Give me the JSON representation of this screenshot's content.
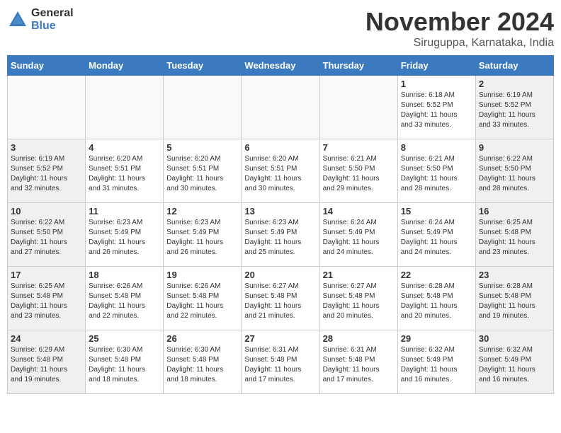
{
  "logo": {
    "general": "General",
    "blue": "Blue"
  },
  "title": "November 2024",
  "location": "Siruguppa, Karnataka, India",
  "weekdays": [
    "Sunday",
    "Monday",
    "Tuesday",
    "Wednesday",
    "Thursday",
    "Friday",
    "Saturday"
  ],
  "weeks": [
    [
      {
        "day": "",
        "info": "",
        "empty": true
      },
      {
        "day": "",
        "info": "",
        "empty": true
      },
      {
        "day": "",
        "info": "",
        "empty": true
      },
      {
        "day": "",
        "info": "",
        "empty": true
      },
      {
        "day": "",
        "info": "",
        "empty": true
      },
      {
        "day": "1",
        "info": "Sunrise: 6:18 AM\nSunset: 5:52 PM\nDaylight: 11 hours\nand 33 minutes."
      },
      {
        "day": "2",
        "info": "Sunrise: 6:19 AM\nSunset: 5:52 PM\nDaylight: 11 hours\nand 33 minutes."
      }
    ],
    [
      {
        "day": "3",
        "info": "Sunrise: 6:19 AM\nSunset: 5:52 PM\nDaylight: 11 hours\nand 32 minutes."
      },
      {
        "day": "4",
        "info": "Sunrise: 6:20 AM\nSunset: 5:51 PM\nDaylight: 11 hours\nand 31 minutes."
      },
      {
        "day": "5",
        "info": "Sunrise: 6:20 AM\nSunset: 5:51 PM\nDaylight: 11 hours\nand 30 minutes."
      },
      {
        "day": "6",
        "info": "Sunrise: 6:20 AM\nSunset: 5:51 PM\nDaylight: 11 hours\nand 30 minutes."
      },
      {
        "day": "7",
        "info": "Sunrise: 6:21 AM\nSunset: 5:50 PM\nDaylight: 11 hours\nand 29 minutes."
      },
      {
        "day": "8",
        "info": "Sunrise: 6:21 AM\nSunset: 5:50 PM\nDaylight: 11 hours\nand 28 minutes."
      },
      {
        "day": "9",
        "info": "Sunrise: 6:22 AM\nSunset: 5:50 PM\nDaylight: 11 hours\nand 28 minutes."
      }
    ],
    [
      {
        "day": "10",
        "info": "Sunrise: 6:22 AM\nSunset: 5:50 PM\nDaylight: 11 hours\nand 27 minutes."
      },
      {
        "day": "11",
        "info": "Sunrise: 6:23 AM\nSunset: 5:49 PM\nDaylight: 11 hours\nand 26 minutes."
      },
      {
        "day": "12",
        "info": "Sunrise: 6:23 AM\nSunset: 5:49 PM\nDaylight: 11 hours\nand 26 minutes."
      },
      {
        "day": "13",
        "info": "Sunrise: 6:23 AM\nSunset: 5:49 PM\nDaylight: 11 hours\nand 25 minutes."
      },
      {
        "day": "14",
        "info": "Sunrise: 6:24 AM\nSunset: 5:49 PM\nDaylight: 11 hours\nand 24 minutes."
      },
      {
        "day": "15",
        "info": "Sunrise: 6:24 AM\nSunset: 5:49 PM\nDaylight: 11 hours\nand 24 minutes."
      },
      {
        "day": "16",
        "info": "Sunrise: 6:25 AM\nSunset: 5:48 PM\nDaylight: 11 hours\nand 23 minutes."
      }
    ],
    [
      {
        "day": "17",
        "info": "Sunrise: 6:25 AM\nSunset: 5:48 PM\nDaylight: 11 hours\nand 23 minutes."
      },
      {
        "day": "18",
        "info": "Sunrise: 6:26 AM\nSunset: 5:48 PM\nDaylight: 11 hours\nand 22 minutes."
      },
      {
        "day": "19",
        "info": "Sunrise: 6:26 AM\nSunset: 5:48 PM\nDaylight: 11 hours\nand 22 minutes."
      },
      {
        "day": "20",
        "info": "Sunrise: 6:27 AM\nSunset: 5:48 PM\nDaylight: 11 hours\nand 21 minutes."
      },
      {
        "day": "21",
        "info": "Sunrise: 6:27 AM\nSunset: 5:48 PM\nDaylight: 11 hours\nand 20 minutes."
      },
      {
        "day": "22",
        "info": "Sunrise: 6:28 AM\nSunset: 5:48 PM\nDaylight: 11 hours\nand 20 minutes."
      },
      {
        "day": "23",
        "info": "Sunrise: 6:28 AM\nSunset: 5:48 PM\nDaylight: 11 hours\nand 19 minutes."
      }
    ],
    [
      {
        "day": "24",
        "info": "Sunrise: 6:29 AM\nSunset: 5:48 PM\nDaylight: 11 hours\nand 19 minutes."
      },
      {
        "day": "25",
        "info": "Sunrise: 6:30 AM\nSunset: 5:48 PM\nDaylight: 11 hours\nand 18 minutes."
      },
      {
        "day": "26",
        "info": "Sunrise: 6:30 AM\nSunset: 5:48 PM\nDaylight: 11 hours\nand 18 minutes."
      },
      {
        "day": "27",
        "info": "Sunrise: 6:31 AM\nSunset: 5:48 PM\nDaylight: 11 hours\nand 17 minutes."
      },
      {
        "day": "28",
        "info": "Sunrise: 6:31 AM\nSunset: 5:48 PM\nDaylight: 11 hours\nand 17 minutes."
      },
      {
        "day": "29",
        "info": "Sunrise: 6:32 AM\nSunset: 5:49 PM\nDaylight: 11 hours\nand 16 minutes."
      },
      {
        "day": "30",
        "info": "Sunrise: 6:32 AM\nSunset: 5:49 PM\nDaylight: 11 hours\nand 16 minutes."
      }
    ]
  ]
}
